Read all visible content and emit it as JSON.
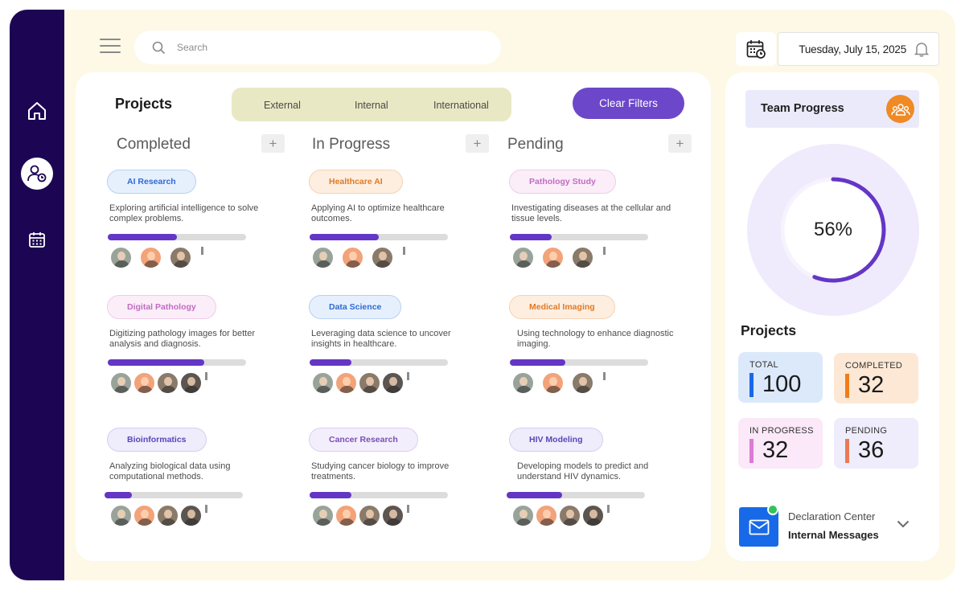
{
  "search": {
    "placeholder": "Search"
  },
  "header": {
    "date": "Tuesday, July 15, 2025"
  },
  "sidebar": {
    "items": [
      {
        "icon": "home-icon"
      },
      {
        "icon": "user-settings-icon",
        "active": true
      },
      {
        "icon": "calendar-icon"
      }
    ]
  },
  "projects_panel": {
    "title": "Projects",
    "filters": [
      "External",
      "Internal",
      "International"
    ],
    "clear_label": "Clear Filters",
    "add_label": "+",
    "columns": [
      {
        "title": "Completed",
        "cards": [
          {
            "tag": "AI Research",
            "desc": "Exploring artificial intelligence to solve complex problems.",
            "progress": 0.5,
            "avatars": 3,
            "tag_bg": "#e6f0fd",
            "tag_color": "#2f6bd4",
            "tag_border": "#b7d0f3"
          },
          {
            "tag": "Digital Pathology",
            "desc": "Digitizing pathology images for better analysis and diagnosis.",
            "progress": 0.7,
            "avatars": 4,
            "tag_bg": "#fbeef9",
            "tag_color": "#c36bc2",
            "tag_border": "#edcdea"
          },
          {
            "tag": "Bioinformatics",
            "desc": "Analyzing biological data using computational methods.",
            "progress": 0.2,
            "avatars": 4,
            "tag_bg": "#efecfb",
            "tag_color": "#5a45b8",
            "tag_border": "#d6cff2"
          }
        ]
      },
      {
        "title": "In Progress",
        "cards": [
          {
            "tag": "Healthcare AI",
            "desc": "Applying AI to optimize healthcare outcomes.",
            "progress": 0.5,
            "avatars": 3,
            "tag_bg": "#fdeee0",
            "tag_color": "#e07a25",
            "tag_border": "#f5d3b3"
          },
          {
            "tag": "Data Science",
            "desc": "Leveraging data science to uncover insights in healthcare.",
            "progress": 0.3,
            "avatars": 4,
            "tag_bg": "#e6f0fd",
            "tag_color": "#2f6bd4",
            "tag_border": "#b7d0f3"
          },
          {
            "tag": "Cancer Research",
            "desc": "Studying cancer biology to improve treatments.",
            "progress": 0.3,
            "avatars": 4,
            "tag_bg": "#f3eefb",
            "tag_color": "#7a4fb5",
            "tag_border": "#dccff0"
          }
        ]
      },
      {
        "title": "Pending",
        "cards": [
          {
            "tag": "Pathology Study",
            "desc": "Investigating diseases at the cellular and tissue levels.",
            "progress": 0.3,
            "avatars": 3,
            "tag_bg": "#fbeef9",
            "tag_color": "#c36bc2",
            "tag_border": "#edcdea"
          },
          {
            "tag": "Medical Imaging",
            "desc": "Using technology to enhance diagnostic imaging.",
            "progress": 0.4,
            "avatars": 3,
            "tag_bg": "#fdeee0",
            "tag_color": "#e07a25",
            "tag_border": "#f5d3b3"
          },
          {
            "tag": "HIV Modeling",
            "desc": "Developing models to predict and understand HIV dynamics.",
            "progress": 0.4,
            "avatars": 4,
            "tag_bg": "#efecfb",
            "tag_color": "#5a45b8",
            "tag_border": "#d6cff2"
          }
        ]
      }
    ]
  },
  "team_progress": {
    "title": "Team Progress",
    "percent_label": "56%",
    "percent": 0.56
  },
  "summary": {
    "title": "Projects",
    "stats": [
      {
        "label": "TOTAL",
        "value": "100",
        "bg": "#dce9fb",
        "bar": "#1769e8"
      },
      {
        "label": "COMPLETED",
        "value": "32",
        "bg": "#fde8d5",
        "bar": "#f07d1a"
      },
      {
        "label": "IN PROGRESS",
        "value": "32",
        "bg": "#fbe8f8",
        "bar": "#dc7ad5"
      },
      {
        "label": "PENDING",
        "value": "36",
        "bg": "#efecfb",
        "bar": "#e97a56"
      }
    ]
  },
  "messages": {
    "title": "Declaration Center",
    "subtitle": "Internal Messages"
  },
  "colors": {
    "sidebar": "#1c0653",
    "accent": "#6c47c9",
    "page": "#fdf9e6"
  }
}
